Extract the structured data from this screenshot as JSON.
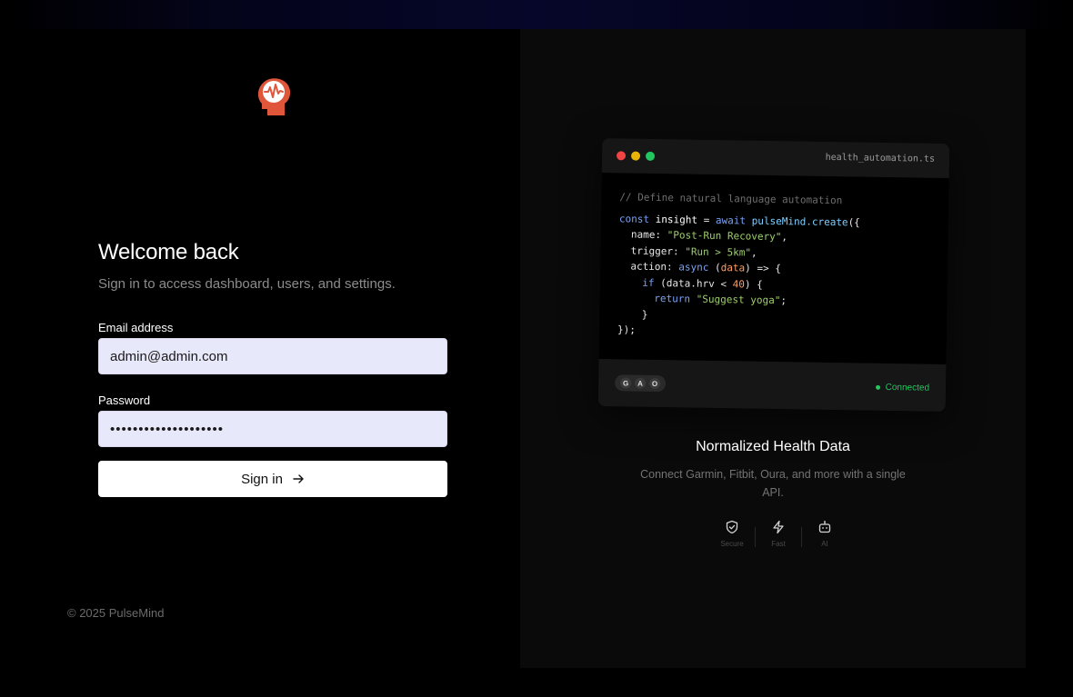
{
  "brand": {
    "name": "PulseMind"
  },
  "login": {
    "title": "Welcome back",
    "subtitle": "Sign in to access dashboard, users, and settings.",
    "email_label": "Email address",
    "email_value": "admin@admin.com",
    "password_label": "Password",
    "password_value": "••••••••••••••••••••",
    "signin_label": "Sign in",
    "copyright": "© 2025 PulseMind"
  },
  "showcase": {
    "code_card": {
      "filename": "health_automation.ts",
      "comment": "// Define natural language automation",
      "avatars": [
        "G",
        "A",
        "O"
      ],
      "status": "Connected"
    },
    "title": "Normalized Health Data",
    "description": "Connect Garmin, Fitbit, Oura, and more with a single API.",
    "features": [
      {
        "label": "Secure",
        "icon": "shield-check-icon"
      },
      {
        "label": "Fast",
        "icon": "lightning-icon"
      },
      {
        "label": "AI",
        "icon": "bot-icon"
      }
    ]
  },
  "colors": {
    "logo_accent": "#e0563b",
    "input_background": "#e8e8fb",
    "status_green": "#22c55e"
  }
}
